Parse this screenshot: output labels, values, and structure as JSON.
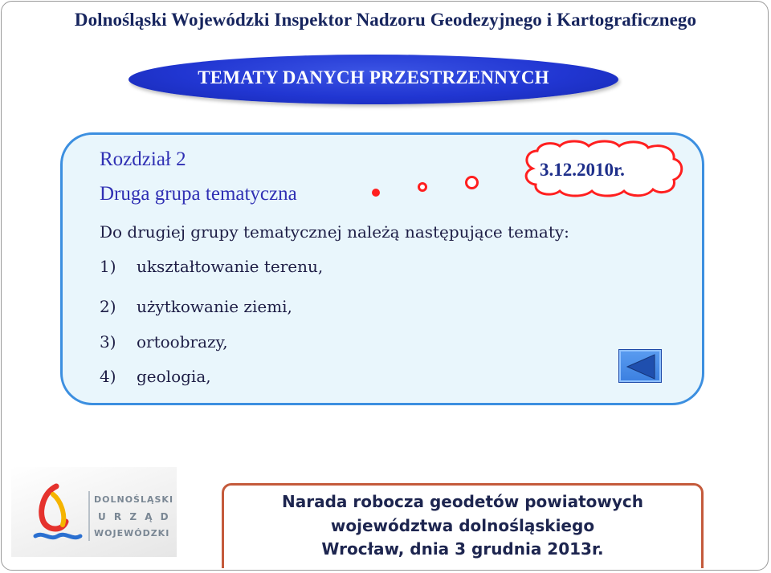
{
  "header": {
    "title": "Dolnośląski Wojewódzki Inspektor Nadzoru Geodezyjnego i Kartograficznego"
  },
  "banner": {
    "label": "TEMATY  DANYCH PRZESTRZENNYCH"
  },
  "section": {
    "chapter": "Rozdział 2",
    "group": "Druga grupa tematyczna",
    "intro": "Do drugiej grupy tematycznej należą następujące tematy:",
    "items": [
      {
        "num": "1)",
        "text": "ukształtowanie terenu,"
      },
      {
        "num": "2)",
        "text": "użytkowanie ziemi,"
      },
      {
        "num": "3)",
        "text": "ortoobrazy,"
      },
      {
        "num": "4)",
        "text": "geologia,"
      }
    ]
  },
  "callout": {
    "date": "3.12.2010r."
  },
  "navigation": {
    "back_icon": "triangle-left-icon"
  },
  "logo": {
    "line1": "DOLNOŚLĄSKI",
    "line2": "U R Z Ą D",
    "line3": "WOJEWÓDZKI"
  },
  "footer": {
    "line1": "Narada robocza geodetów powiatowych",
    "line2": "województwa dolnośląskiego",
    "line3": "Wrocław, dnia 3 grudnia 2013r."
  },
  "colors": {
    "panel_border": "#3c8fe0",
    "banner": "#2136d2",
    "callout": "#ff1f1f",
    "heading_text": "#3030b4"
  }
}
